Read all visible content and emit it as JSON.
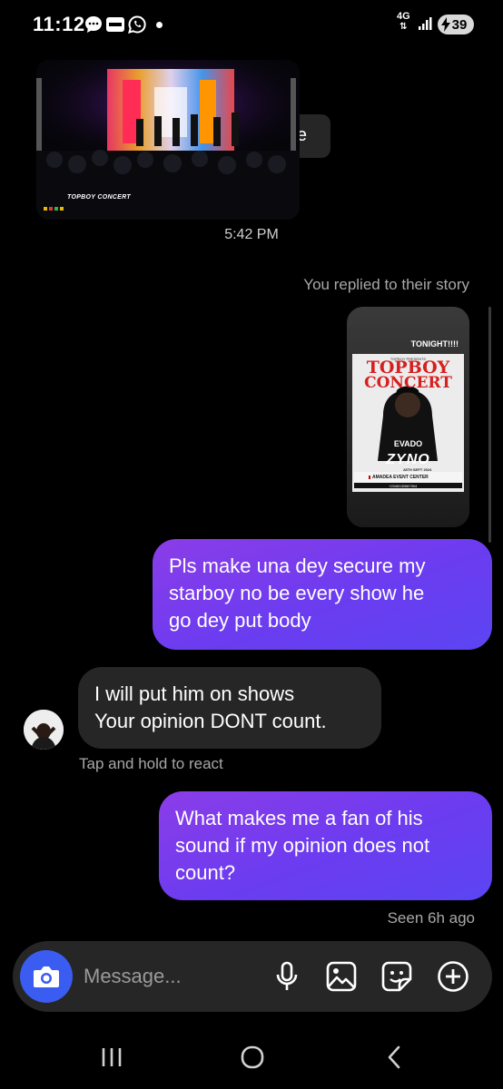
{
  "status_bar": {
    "time": "11:12",
    "network": "4G",
    "battery": "39",
    "icons": [
      "messages-icon",
      "bybit-icon",
      "whatsapp-icon",
      "notification-dot-icon",
      "network-icon",
      "signal-icon",
      "battery-charging-icon"
    ]
  },
  "shared_post": {
    "caption": "TOPBOY CONCERT",
    "bubble_tail_text": "e"
  },
  "timestamp": "5:42 PM",
  "reply_note": "You replied to their story",
  "story_card": {
    "badge": "TONIGHT!!!!",
    "presenter": "TOPBOY PRESENTS",
    "title_line1": "TOPBOY",
    "title_line2": "CONCERT",
    "artist1": "EVADO",
    "artist2": "ZYNO",
    "date": "28TH SEPT 2024",
    "venue": "AMADEA EVENT CENTER",
    "phone": "+2348130587904"
  },
  "messages": [
    {
      "direction": "outgoing",
      "text": "Pls make una dey secure my\nstarboy no be every show he\ngo dey put body"
    },
    {
      "direction": "incoming",
      "text": "I will put him on shows\nYour opinion DONT count."
    },
    {
      "direction": "outgoing",
      "text": "What makes me a fan of his\nsound if my opinion does not\ncount?"
    }
  ],
  "react_hint": "Tap and hold to react",
  "seen_status": "Seen 6h ago",
  "composer": {
    "placeholder": "Message...",
    "icons": [
      "camera-icon",
      "microphone-icon",
      "gallery-icon",
      "sticker-icon",
      "add-icon"
    ]
  },
  "nav": [
    "recents-icon",
    "home-icon",
    "back-icon"
  ],
  "colors": {
    "background": "#000000",
    "incoming_bubble": "#262626",
    "outgoing_gradient_start": "#8b3de8",
    "outgoing_gradient_end": "#5b45f2",
    "camera_button": "#3a5cf0",
    "secondary_text": "#a8a8a8"
  }
}
